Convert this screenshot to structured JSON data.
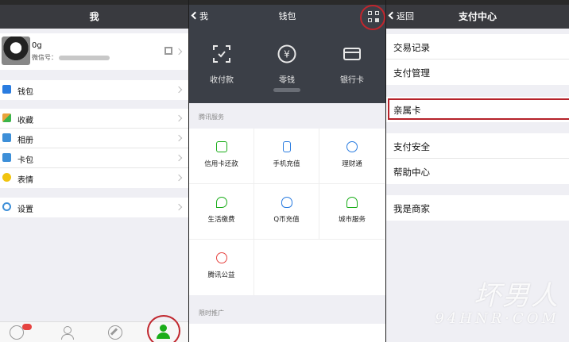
{
  "me": {
    "title": "我",
    "profile": {
      "name": "0g",
      "wechat_id_label": "微信号："
    },
    "menu_groups": [
      [
        {
          "label": "钱包",
          "icon": "wallet-icon",
          "color": "#2a7ce0"
        }
      ],
      [
        {
          "label": "收藏",
          "icon": "favorites-icon",
          "color": "#e9a33b"
        },
        {
          "label": "相册",
          "icon": "album-icon",
          "color": "#3d8fd8"
        },
        {
          "label": "卡包",
          "icon": "card-pack-icon",
          "color": "#3d8fd8"
        },
        {
          "label": "表情",
          "icon": "sticker-icon",
          "color": "#f1c40f"
        }
      ],
      [
        {
          "label": "设置",
          "icon": "settings-icon",
          "color": "#3d8fd8"
        }
      ]
    ],
    "accent": "#1aad19",
    "highlight": "#c0262d"
  },
  "wallet": {
    "title": "钱包",
    "back": "我",
    "top_items": [
      {
        "label": "收付款",
        "icon": "scan-pay-icon"
      },
      {
        "label": "零钱",
        "icon": "yen-icon"
      },
      {
        "label": "银行卡",
        "icon": "bank-card-icon"
      }
    ],
    "section1": "腾讯服务",
    "services": [
      {
        "label": "信用卡还款",
        "icon": "credit-card-icon",
        "color": "#1aad19"
      },
      {
        "label": "手机充值",
        "icon": "phone-topup-icon",
        "color": "#2a7ce0"
      },
      {
        "label": "理财通",
        "icon": "licaitong-icon",
        "color": "#2a7ce0"
      },
      {
        "label": "生活缴费",
        "icon": "utility-icon",
        "color": "#1aad19"
      },
      {
        "label": "Q币充值",
        "icon": "qcoin-icon",
        "color": "#2a7ce0"
      },
      {
        "label": "城市服务",
        "icon": "city-service-icon",
        "color": "#1aad19"
      },
      {
        "label": "腾讯公益",
        "icon": "charity-icon",
        "color": "#e64340"
      }
    ],
    "section2": "限时推广"
  },
  "payment": {
    "title": "支付中心",
    "back": "返回",
    "groups": [
      [
        {
          "label": "交易记录"
        },
        {
          "label": "支付管理"
        }
      ],
      [
        {
          "label": "亲属卡"
        }
      ],
      [
        {
          "label": "支付安全"
        },
        {
          "label": "帮助中心"
        }
      ],
      [
        {
          "label": "我是商家"
        }
      ]
    ]
  },
  "watermark": {
    "line1": "坏男人",
    "line2": "94HNR·COM"
  }
}
